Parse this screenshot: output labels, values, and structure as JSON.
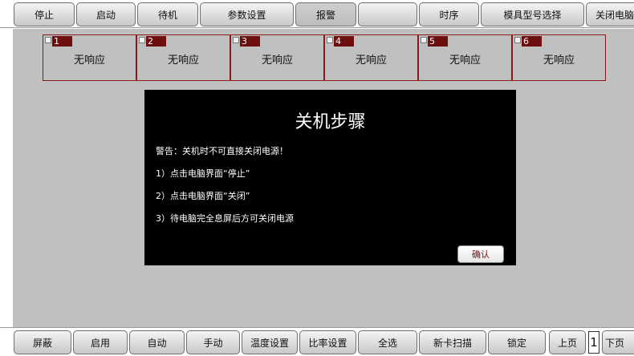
{
  "topbar": {
    "buttons": [
      "停止",
      "启动",
      "待机",
      "参数设置",
      "报警",
      "",
      "时序",
      "模具型号选择",
      "关闭电脑"
    ]
  },
  "tiles": [
    {
      "number": "1",
      "status": "无响应"
    },
    {
      "number": "2",
      "status": "无响应"
    },
    {
      "number": "3",
      "status": "无响应"
    },
    {
      "number": "4",
      "status": "无响应"
    },
    {
      "number": "5",
      "status": "无响应"
    },
    {
      "number": "6",
      "status": "无响应"
    }
  ],
  "dialog": {
    "title": "关机步骤",
    "lines": [
      "警告：关机时不可直接关闭电源！",
      "1）点击电脑界面“停止”",
      "2）点击电脑界面“关闭”",
      "3）待电脑完全息屏后方可关闭电源"
    ],
    "confirm_label": "确认"
  },
  "bottombar": {
    "buttons": [
      "屏蔽",
      "启用",
      "自动",
      "手动",
      "温度设置",
      "比率设置",
      "全选",
      "新卡扫描",
      "锁定"
    ],
    "prev_label": "上页",
    "page": "1",
    "next_label": "下页"
  }
}
